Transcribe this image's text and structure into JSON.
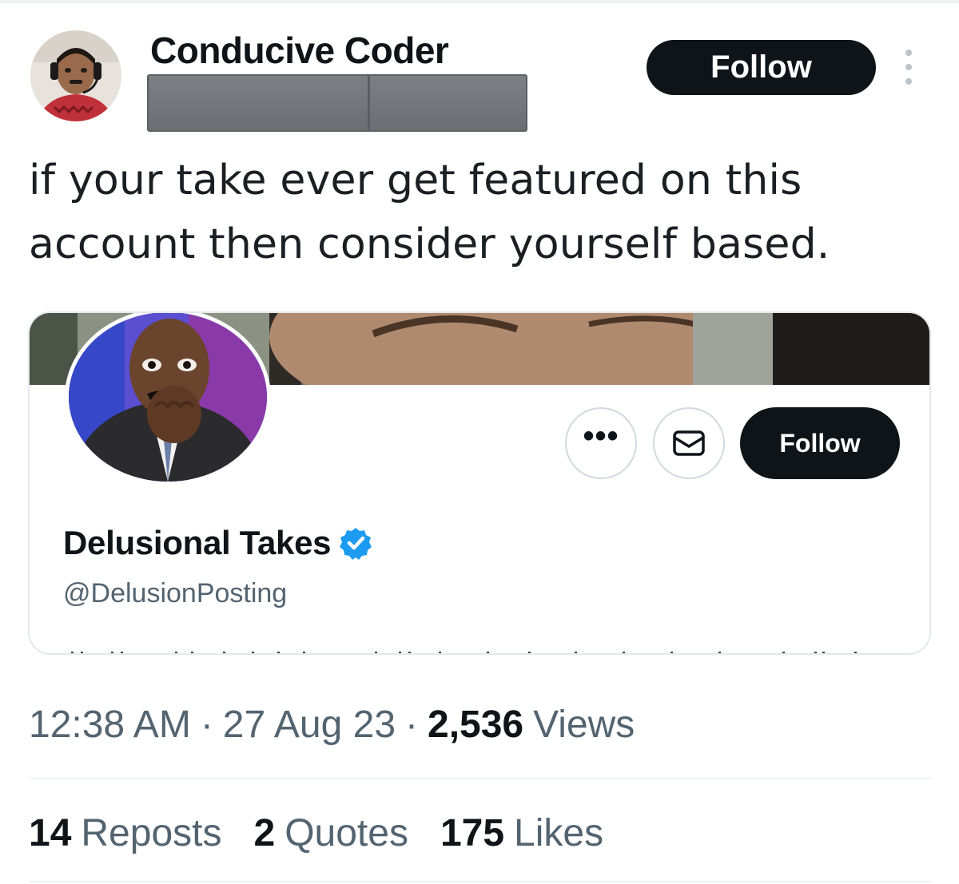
{
  "tweet": {
    "author_name": "Conducive Coder",
    "follow_label": "Follow",
    "text": "if your take ever get featured on this account then consider yourself based.",
    "time": "12:38 AM",
    "date": "27 Aug 23",
    "views_count": "2,536",
    "views_label": "Views",
    "separator": "·"
  },
  "embedded_profile": {
    "display_name": "Delusional Takes",
    "handle": "@DelusionPosting",
    "verified": true,
    "follow_label": "Follow",
    "more_label": "•••"
  },
  "stats": [
    {
      "count": "14",
      "label": "Reposts"
    },
    {
      "count": "2",
      "label": "Quotes"
    },
    {
      "count": "175",
      "label": "Likes"
    }
  ],
  "colors": {
    "text_primary": "#0f1419",
    "text_secondary": "#536471",
    "button_dark": "#0f1419",
    "verified_blue": "#1d9bf0"
  },
  "icons": {
    "kebab": "more-vertical-icon",
    "more": "more-horizontal-icon",
    "message": "envelope-icon",
    "verified": "verified-badge-icon"
  }
}
